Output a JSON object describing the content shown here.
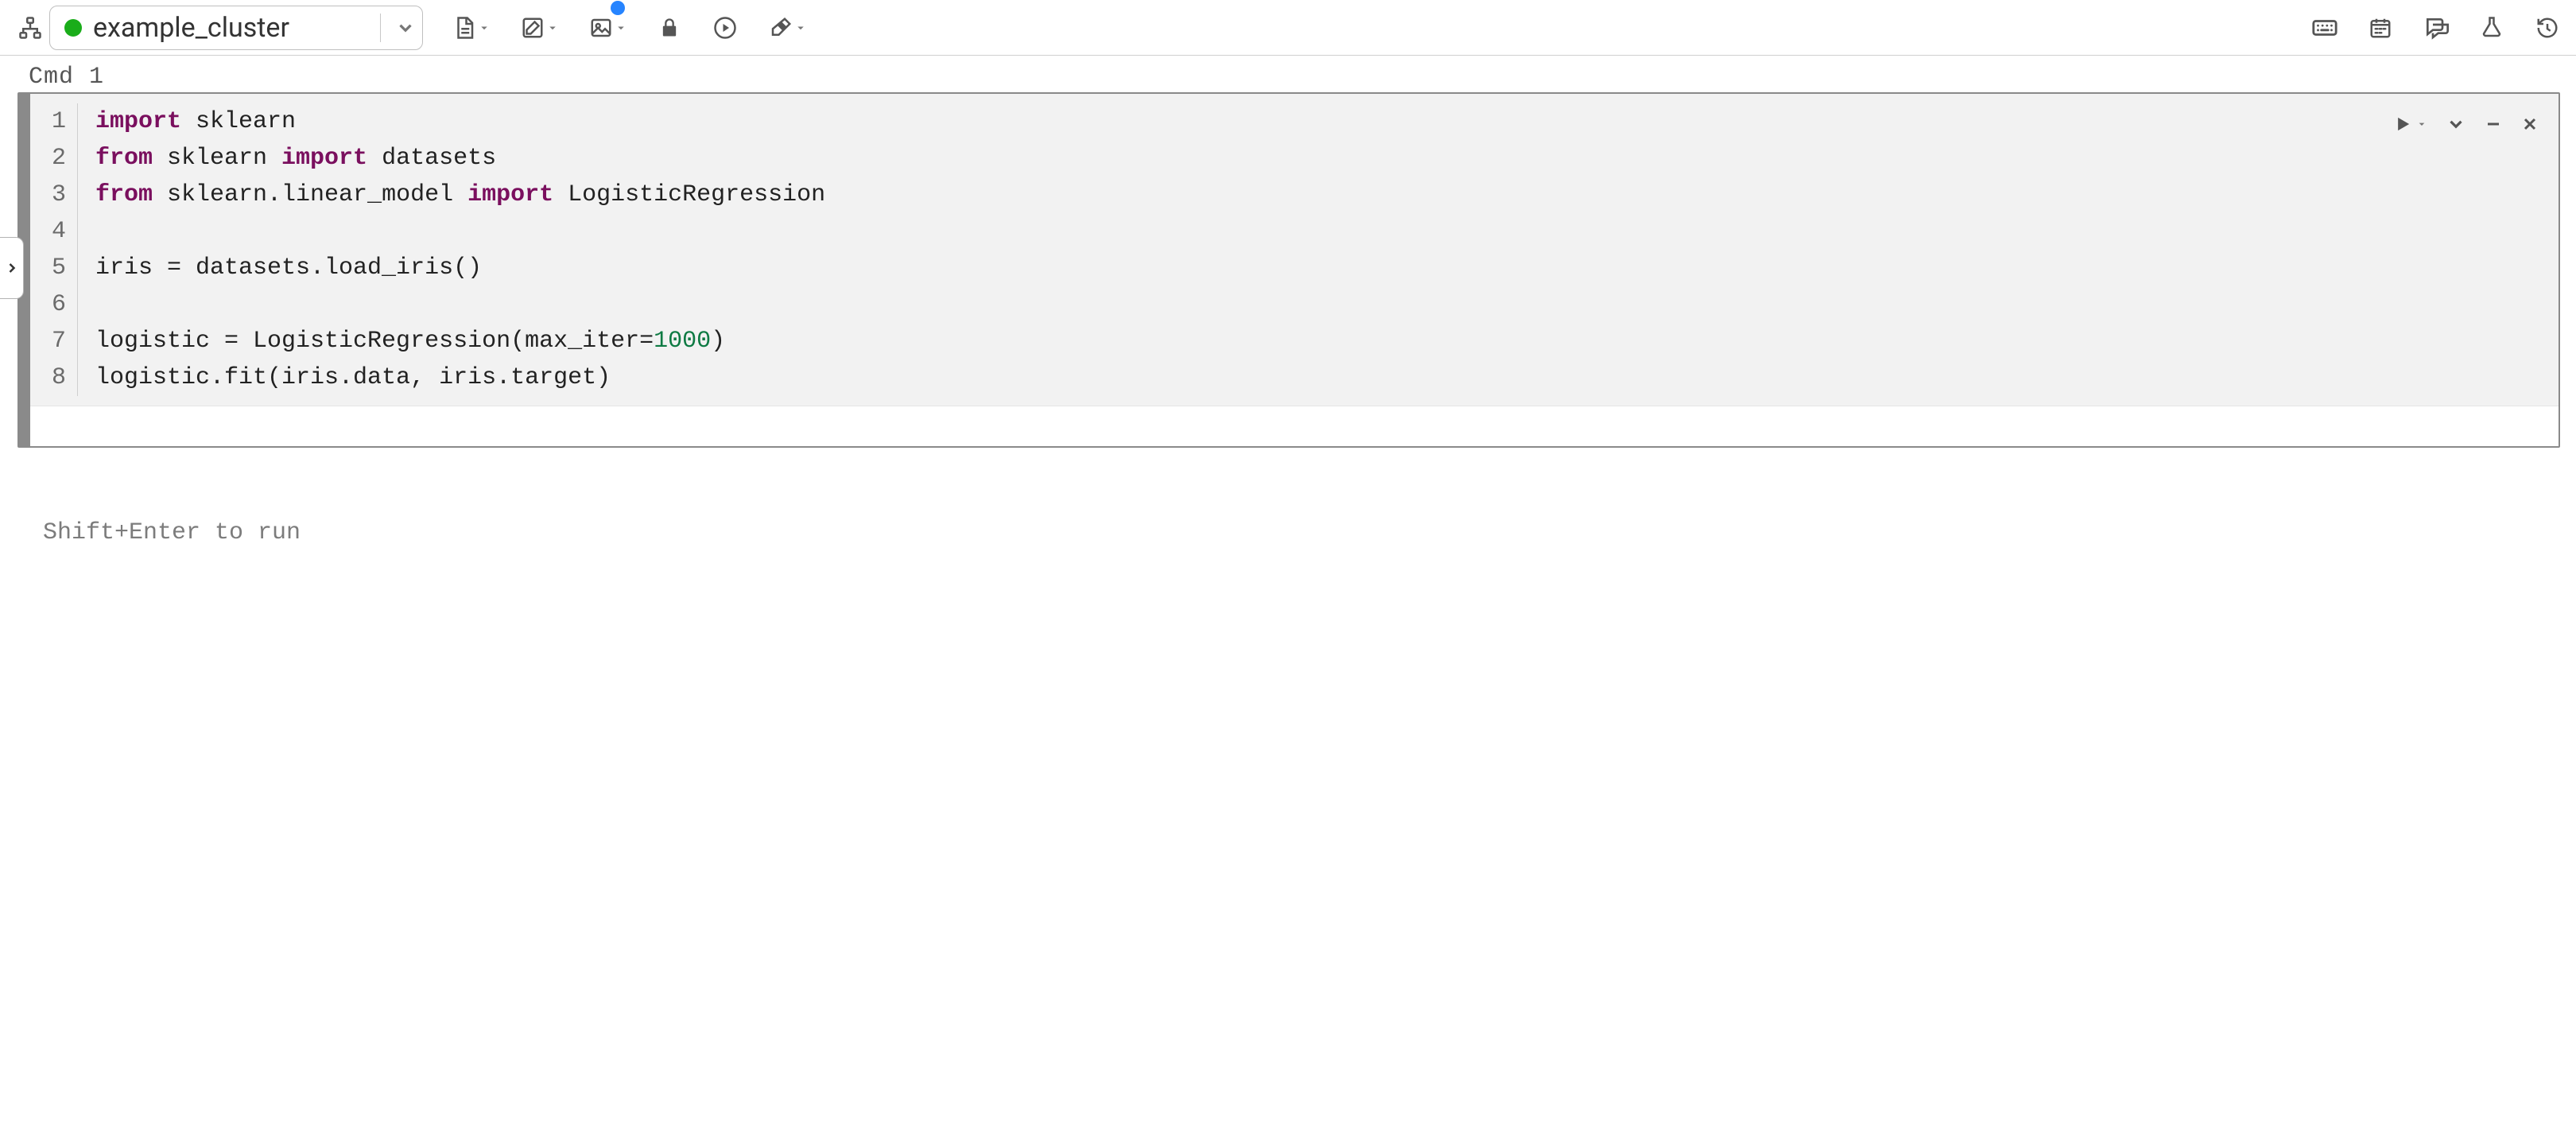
{
  "toolbar": {
    "cluster_name": "example_cluster",
    "cluster_status_color": "#1aad1a",
    "icons": {
      "workspace_tree": "workspace-tree-icon",
      "file_menu": "file-doc-icon",
      "edit_menu": "edit-pencil-icon",
      "chart_menu": "image-icon",
      "lock": "lock-icon",
      "run_all": "run-circle-icon",
      "clear_menu": "eraser-icon",
      "keyboard": "keyboard-icon",
      "schedule": "calendar-icon",
      "comments": "comments-icon",
      "experiments": "flask-icon",
      "history": "history-icon"
    },
    "chart_has_notification": true
  },
  "cell": {
    "label": "Cmd 1",
    "code_lines": [
      {
        "n": 1,
        "tokens": [
          {
            "t": "import",
            "c": "kw"
          },
          {
            "t": " sklearn",
            "c": "pln"
          }
        ]
      },
      {
        "n": 2,
        "tokens": [
          {
            "t": "from",
            "c": "kw"
          },
          {
            "t": " sklearn ",
            "c": "pln"
          },
          {
            "t": "import",
            "c": "kw"
          },
          {
            "t": " datasets",
            "c": "pln"
          }
        ]
      },
      {
        "n": 3,
        "tokens": [
          {
            "t": "from",
            "c": "kw"
          },
          {
            "t": " sklearn.linear_model ",
            "c": "pln"
          },
          {
            "t": "import",
            "c": "kw"
          },
          {
            "t": " LogisticRegression",
            "c": "pln"
          }
        ]
      },
      {
        "n": 4,
        "tokens": [
          {
            "t": "",
            "c": "pln"
          }
        ]
      },
      {
        "n": 5,
        "tokens": [
          {
            "t": "iris = datasets.load_iris()",
            "c": "pln"
          }
        ]
      },
      {
        "n": 6,
        "tokens": [
          {
            "t": "",
            "c": "pln"
          }
        ]
      },
      {
        "n": 7,
        "tokens": [
          {
            "t": "logistic = LogisticRegression(max_iter=",
            "c": "pln"
          },
          {
            "t": "1000",
            "c": "num"
          },
          {
            "t": ")",
            "c": "pln"
          }
        ]
      },
      {
        "n": 8,
        "tokens": [
          {
            "t": "logistic.fit(iris.data, iris.target)",
            "c": "pln"
          }
        ]
      }
    ],
    "actions": {
      "run": "run-cell",
      "confirm": "confirm-cell",
      "minimize": "minimize-cell",
      "close": "close-cell"
    }
  },
  "hint": "Shift+Enter to run"
}
